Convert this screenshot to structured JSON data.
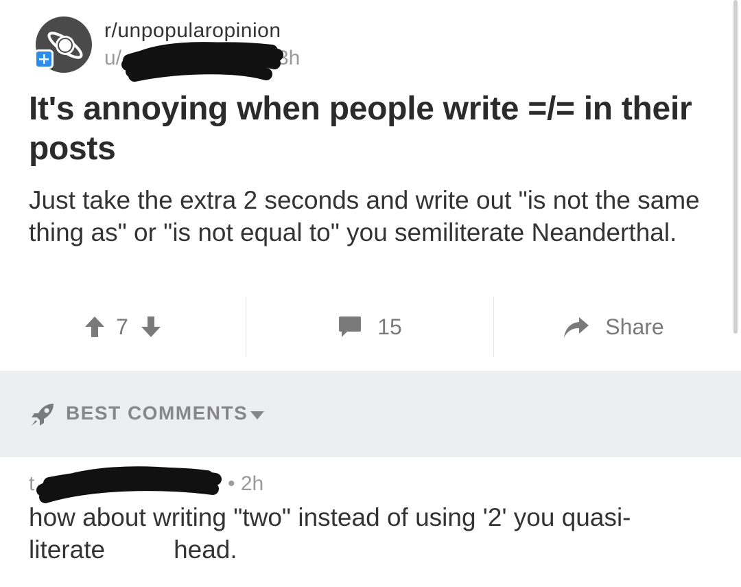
{
  "post": {
    "subreddit": "r/unpopularopinion",
    "user_prefix": "u/",
    "age": "3h",
    "title": "It's annoying when people write =/= in their posts",
    "body": "Just take the extra 2 seconds and write out \"is not the same thing as\" or \"is not equal to\" you semiliterate Neanderthal."
  },
  "actions": {
    "score": "7",
    "comments": "15",
    "share": "Share"
  },
  "comments_header": {
    "sort_label": "BEST COMMENTS"
  },
  "comment": {
    "age": "• 2h",
    "body_line1": "how about writing \"two\" instead of using '2' you quasi-",
    "body_word1": "literate",
    "body_word2": "head."
  },
  "icons": {
    "subreddit_avatar": "saturn-planet-icon",
    "join": "plus-icon",
    "upvote": "arrow-up-icon",
    "downvote": "arrow-down-icon",
    "comments": "speech-bubble-icon",
    "share": "share-arrow-icon",
    "sort": "rocket-icon",
    "dropdown": "caret-down-icon"
  },
  "colors": {
    "accent_blue": "#2d8bea",
    "icon_gray": "#7a7a7a",
    "band_gray": "#edeef0"
  }
}
